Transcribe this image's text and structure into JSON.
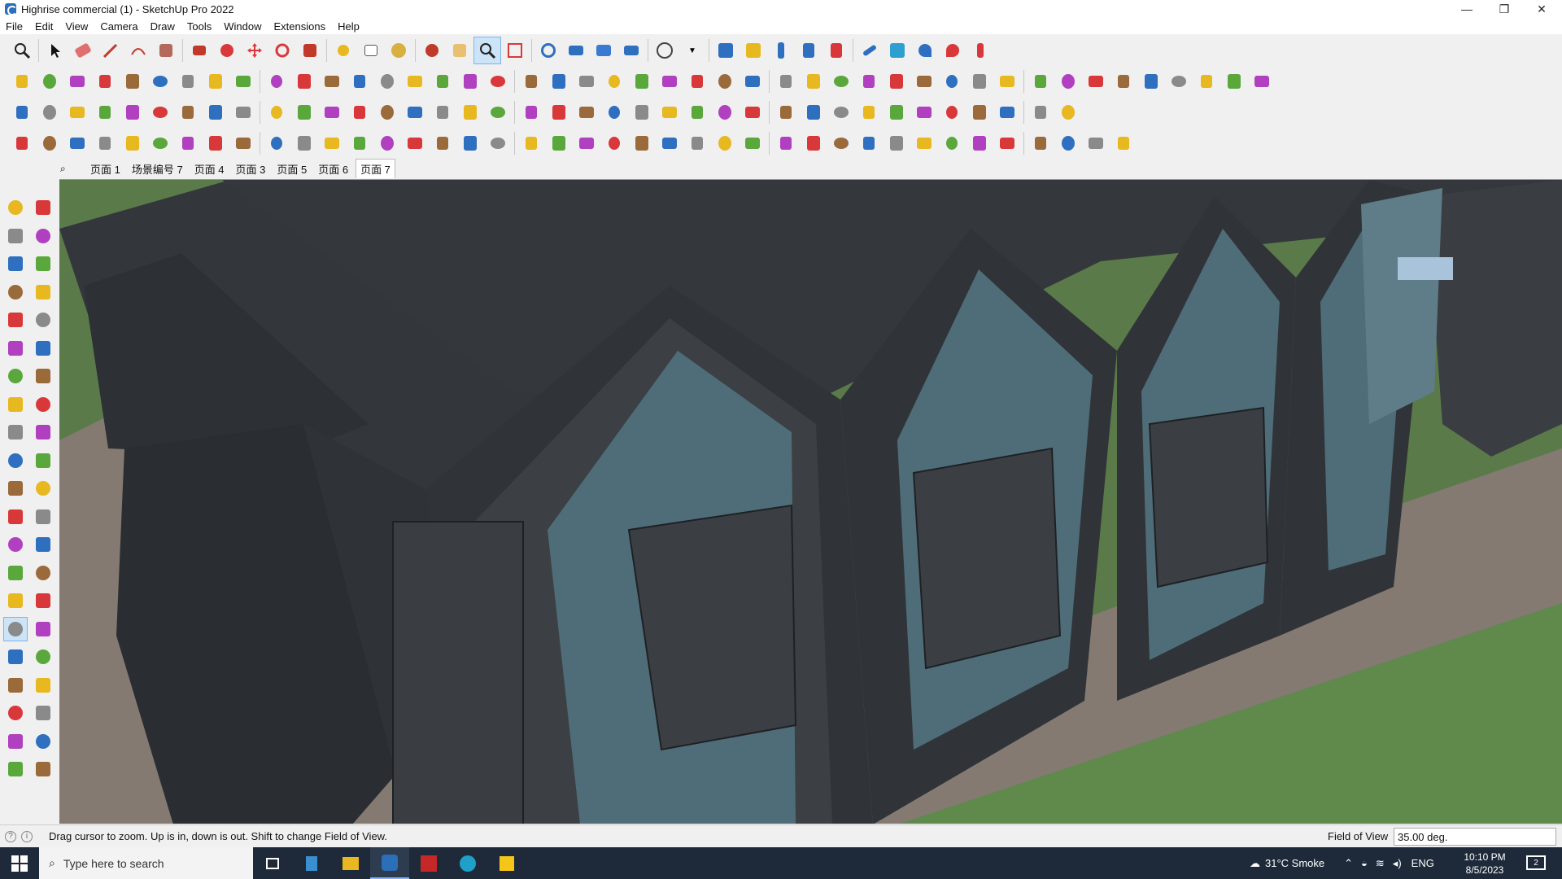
{
  "window": {
    "title": "Highrise commercial (1) - SketchUp Pro 2022",
    "minimize": "—",
    "maximize": "❐",
    "close": "✕"
  },
  "menu": [
    "File",
    "Edit",
    "View",
    "Camera",
    "Draw",
    "Tools",
    "Window",
    "Extensions",
    "Help"
  ],
  "scenes": {
    "tabs": [
      "页面 1",
      "场景编号 7",
      "页面 4",
      "页面 3",
      "页面 5",
      "页面 6",
      "页面 7"
    ],
    "active": "页面 7"
  },
  "status": {
    "hint": "Drag cursor to zoom.  Up is in, down is out. Shift to change Field of View.",
    "vcb_label": "Field of View",
    "vcb_value": "35.00 deg."
  },
  "taskbar": {
    "search_placeholder": "Type here to search",
    "weather": "31°C  Smoke",
    "language": "ENG",
    "time": "10:10 PM",
    "date": "8/5/2023",
    "notification_count": "2"
  },
  "toolbar_colors": {
    "red": "#d9383a",
    "blue": "#2f6fc0",
    "yellow": "#e8b820",
    "green": "#5aa83c",
    "grey": "#8a8a8a",
    "brown": "#9a6a3a",
    "purple": "#b040c0"
  },
  "scene_colors": {
    "roof": "#2e3236",
    "wall": "#3a3e42",
    "glass": "#4f6d78",
    "grass": "#5b7a4a",
    "path": "#847a72"
  }
}
